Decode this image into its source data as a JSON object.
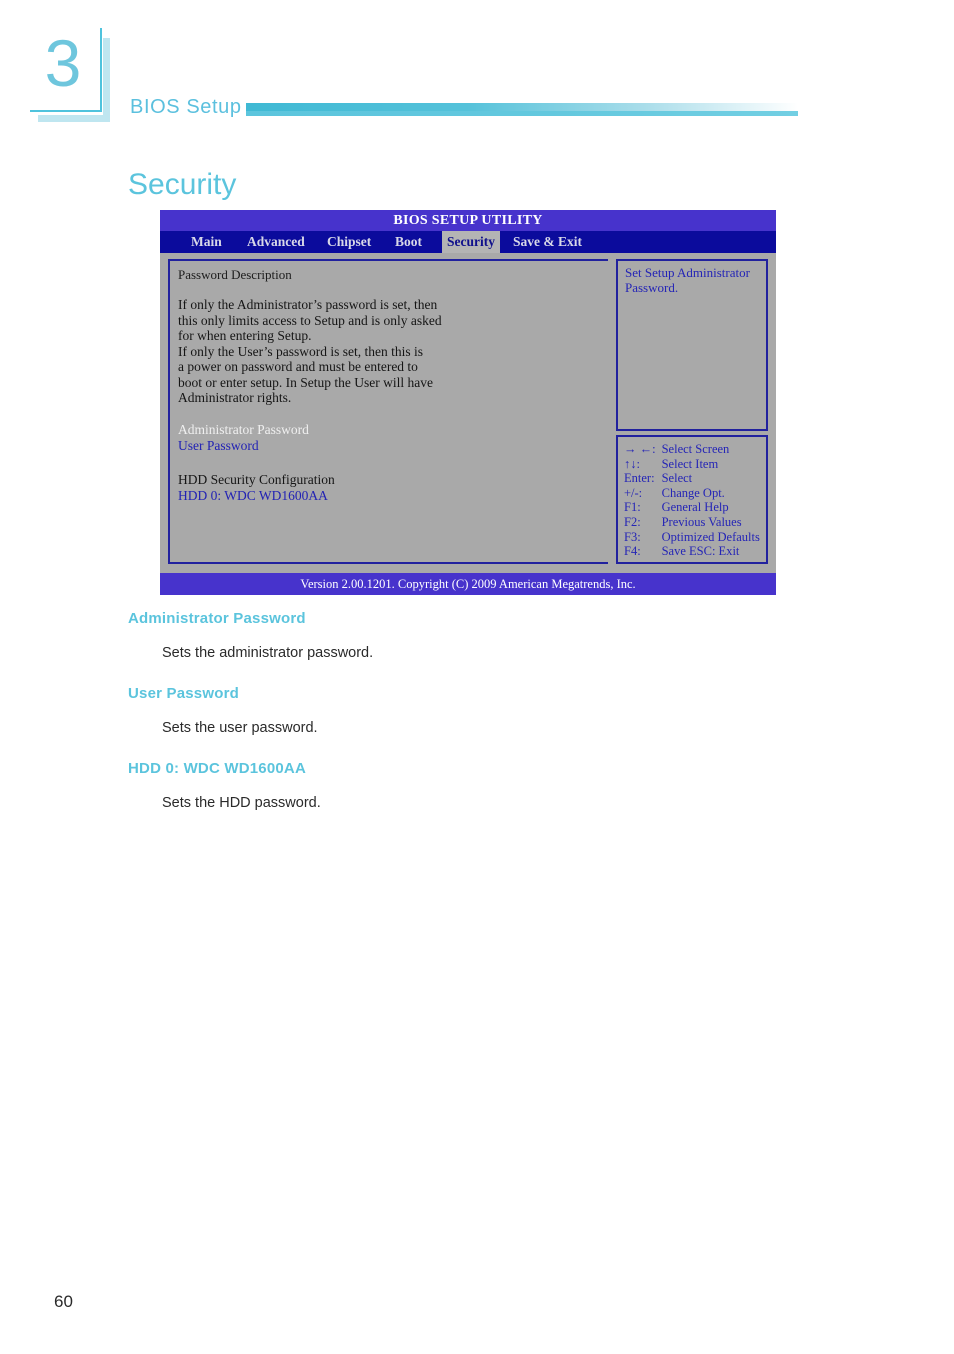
{
  "chapter": {
    "number": "3",
    "title": "BIOS Setup"
  },
  "page_title": "Security",
  "bios": {
    "title": "BIOS SETUP UTILITY",
    "tabs": [
      {
        "label": "Main",
        "active": false
      },
      {
        "label": "Advanced",
        "active": false
      },
      {
        "label": "Chipset",
        "active": false
      },
      {
        "label": "Boot",
        "active": false
      },
      {
        "label": "Security",
        "active": true
      },
      {
        "label": "Save & Exit",
        "active": false
      }
    ],
    "left_panel": {
      "password_description_title": "Password Description",
      "description_lines": [
        "If only the Administrator’s password is set, then",
        "this only limits access to Setup and is only asked",
        "for when entering Setup.",
        "If only the User’s password is set, then this is",
        "a power on password and must be entered to",
        "boot or enter setup. In Setup the User will have",
        "Administrator rights."
      ],
      "administrator_password": "Administrator Password",
      "user_password": "User Password",
      "hdd_security_configuration": "HDD Security Configuration",
      "hdd_0": "HDD 0: WDC WD1600AA"
    },
    "help_panel": {
      "text": "Set Setup Administrator Password."
    },
    "legend": [
      {
        "key": "→ ←:",
        "action": "Select Screen"
      },
      {
        "key": "↑↓:",
        "action": "Select Item"
      },
      {
        "key": "Enter:",
        "action": "Select"
      },
      {
        "key": "+/-:",
        "action": "Change Opt."
      },
      {
        "key": "F1:",
        "action": "General Help"
      },
      {
        "key": "F2:",
        "action": "Previous Values"
      },
      {
        "key": "F3:",
        "action": "Optimized Defaults"
      },
      {
        "key": "F4:",
        "action": "Save   ESC: Exit"
      }
    ],
    "footer": "Version 2.00.1201. Copyright (C) 2009 American Megatrends, Inc."
  },
  "sections": [
    {
      "heading": "Administrator Password",
      "body": "Sets the administrator password."
    },
    {
      "heading": "User Password",
      "body": "Sets the user password."
    },
    {
      "heading": "HDD 0: WDC WD1600AA",
      "body": "Sets the HDD password."
    }
  ],
  "page_number": "60",
  "colors": {
    "accent_cyan": "#5bc4dd",
    "bios_title_bar": "#4733cc",
    "bios_menu_bar": "#0b0b9c",
    "bios_body": "#a9a9a9",
    "bios_border": "#21219e",
    "bios_link_blue": "#2222b4"
  }
}
